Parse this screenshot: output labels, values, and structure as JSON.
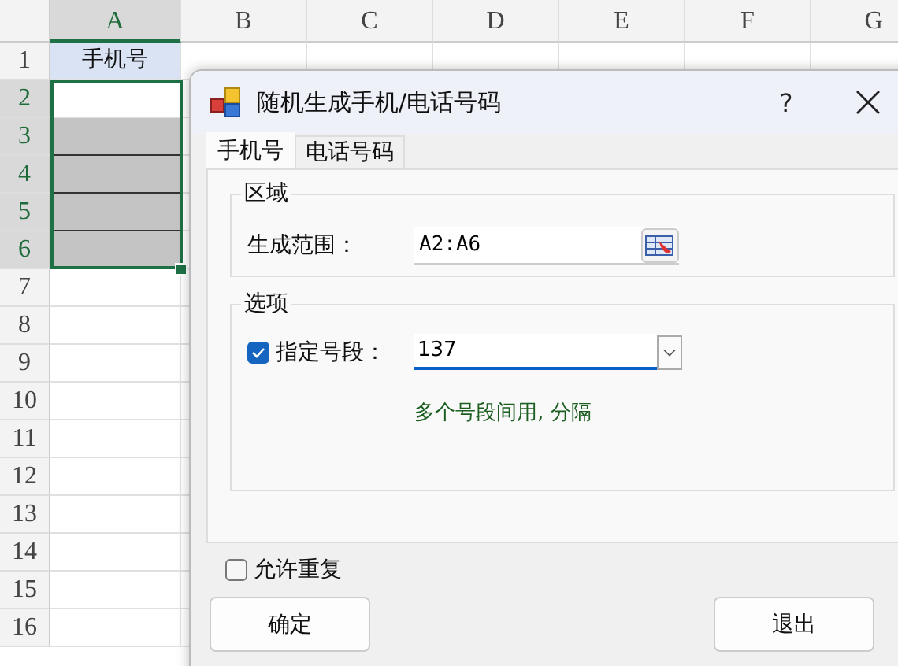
{
  "sheet": {
    "columns": [
      {
        "label": "A",
        "selected": true
      },
      {
        "label": "B",
        "selected": false
      },
      {
        "label": "C",
        "selected": false
      },
      {
        "label": "D",
        "selected": false
      },
      {
        "label": "E",
        "selected": false
      },
      {
        "label": "F",
        "selected": false
      },
      {
        "label": "G",
        "selected": false
      }
    ],
    "rows": [
      {
        "label": "1",
        "selected": false,
        "cell_a": {
          "kind": "header",
          "text": "手机号"
        }
      },
      {
        "label": "2",
        "selected": true,
        "cell_a": {
          "kind": "blank"
        }
      },
      {
        "label": "3",
        "selected": true,
        "cell_a": {
          "kind": "shaded"
        }
      },
      {
        "label": "4",
        "selected": true,
        "cell_a": {
          "kind": "shaded"
        }
      },
      {
        "label": "5",
        "selected": true,
        "cell_a": {
          "kind": "shaded"
        }
      },
      {
        "label": "6",
        "selected": true,
        "cell_a": {
          "kind": "shaded"
        }
      },
      {
        "label": "7",
        "selected": false,
        "cell_a": {
          "kind": "blank"
        }
      },
      {
        "label": "8",
        "selected": false,
        "cell_a": {
          "kind": "blank"
        }
      },
      {
        "label": "9",
        "selected": false,
        "cell_a": {
          "kind": "blank"
        }
      },
      {
        "label": "10",
        "selected": false,
        "cell_a": {
          "kind": "blank"
        }
      },
      {
        "label": "11",
        "selected": false,
        "cell_a": {
          "kind": "blank"
        }
      },
      {
        "label": "12",
        "selected": false,
        "cell_a": {
          "kind": "blank"
        }
      },
      {
        "label": "13",
        "selected": false,
        "cell_a": {
          "kind": "blank"
        }
      },
      {
        "label": "14",
        "selected": false,
        "cell_a": {
          "kind": "blank"
        }
      },
      {
        "label": "15",
        "selected": false,
        "cell_a": {
          "kind": "blank"
        }
      },
      {
        "label": "16",
        "selected": false,
        "cell_a": {
          "kind": "blank"
        }
      }
    ]
  },
  "dialog": {
    "title": "随机生成手机/电话号码",
    "help": "?",
    "tabs": [
      {
        "label": "手机号",
        "selected": true
      },
      {
        "label": "电话号码",
        "selected": false
      }
    ],
    "region_group": {
      "title": "区域",
      "label": "生成范围：",
      "value": "A2:A6"
    },
    "options_group": {
      "title": "选项",
      "prefix_checkbox": {
        "label": "指定号段：",
        "checked": true
      },
      "prefix_value": "137",
      "hint": "多个号段间用, 分隔"
    },
    "allow_repeat": {
      "label": "允许重复",
      "checked": false
    },
    "buttons": [
      {
        "label": "确定"
      },
      {
        "label": "退出"
      }
    ]
  }
}
